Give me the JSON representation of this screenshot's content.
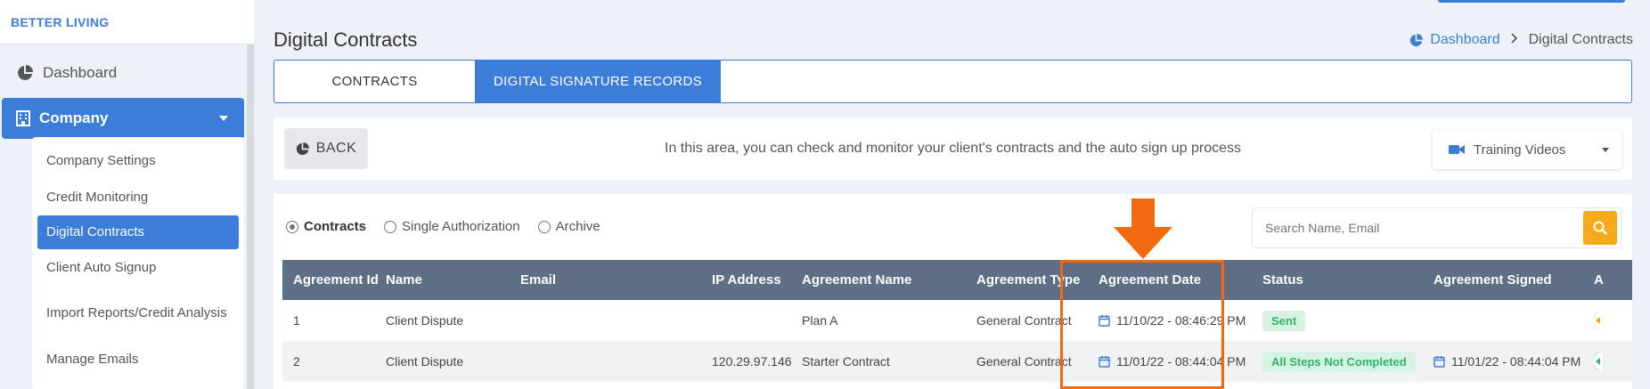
{
  "brand": "BETTER LIVING",
  "sidebar": {
    "dashboard": "Dashboard",
    "company": "Company",
    "submenu": [
      "Company Settings",
      "Credit Monitoring",
      "Digital Contracts",
      "Client Auto Signup",
      "Import Reports/Credit Analysis",
      "Manage Emails"
    ],
    "active_submenu": "Digital Contracts"
  },
  "header": {
    "title": "Digital Contracts",
    "breadcrumb": [
      "Dashboard",
      "Digital Contracts"
    ]
  },
  "tabs": [
    {
      "label": "CONTRACTS",
      "active": false
    },
    {
      "label": "DIGITAL SIGNATURE RECORDS",
      "active": true
    }
  ],
  "infobar": {
    "back_label": "BACK",
    "message": "In this area, you can check and monitor your client's contracts and the auto sign up process",
    "training_label": "Training Videos"
  },
  "filters": {
    "options": [
      "Contracts",
      "Single Authorization",
      "Archive"
    ],
    "selected": "Contracts"
  },
  "search": {
    "placeholder": "Search Name, Email",
    "value": ""
  },
  "table": {
    "columns": [
      "Agreement Id",
      "Name",
      "Email",
      "IP Address",
      "Agreement Name",
      "Agreement Type",
      "Agreement Date",
      "Status",
      "Agreement Signed",
      "A"
    ],
    "rows": [
      {
        "id": "1",
        "name": "Client Dispute",
        "email": "",
        "ip": "",
        "agreement_name": "Plan A",
        "agreement_type": "General Contract",
        "agreement_date": "11/10/22 - 08:46:29 PM",
        "status": "Sent",
        "agreement_signed": ""
      },
      {
        "id": "2",
        "name": "Client Dispute",
        "email": "",
        "ip": "120.29.97.146",
        "agreement_name": "Starter Contract",
        "agreement_type": "General Contract",
        "agreement_date": "11/01/22 - 08:44:04 PM",
        "status": "All Steps Not Completed",
        "agreement_signed": "11/01/22 - 08:44:04 PM"
      }
    ]
  },
  "colors": {
    "primary": "#3b7dd8",
    "table_header": "#5d6e85",
    "search_button": "#f6a91b",
    "highlight": "#f26a10",
    "status_green": "#2fb56a"
  },
  "icons": {
    "dashboard": "pie-chart-icon",
    "company": "building-icon",
    "training": "video-camera-icon",
    "search": "search-icon",
    "calendar": "calendar-icon"
  }
}
